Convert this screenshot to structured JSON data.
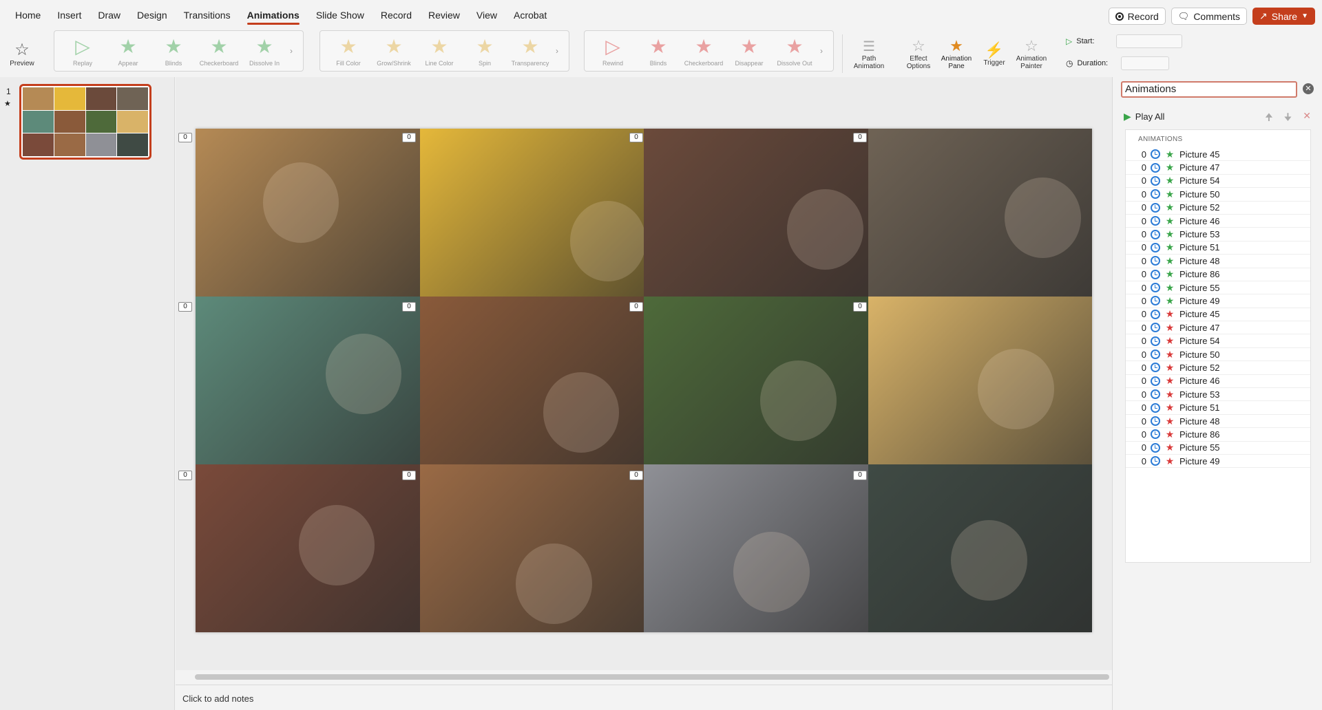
{
  "menu": {
    "tabs": [
      "Home",
      "Insert",
      "Draw",
      "Design",
      "Transitions",
      "Animations",
      "Slide Show",
      "Record",
      "Review",
      "View",
      "Acrobat"
    ],
    "active_tab": "Animations",
    "record_button": "Record",
    "comments_button": "Comments",
    "share_button": "Share"
  },
  "ribbon": {
    "preview_label": "Preview",
    "entrance_effects": [
      "Replay",
      "Appear",
      "Blinds",
      "Checkerboard",
      "Dissolve In"
    ],
    "emphasis_effects": [
      "Fill Color",
      "Grow/Shrink",
      "Line Color",
      "Spin",
      "Transparency"
    ],
    "exit_effects": [
      "Rewind",
      "Blinds",
      "Checkerboard",
      "Disappear",
      "Dissolve Out"
    ],
    "path_animation": "Path Animation",
    "effect_options": "Effect Options",
    "animation_pane": "Animation Pane",
    "trigger": "Trigger",
    "animation_painter": "Animation Painter",
    "start_label": "Start:",
    "duration_label": "Duration:"
  },
  "thumbnails": {
    "slide_number": "1",
    "star": "★"
  },
  "slide": {
    "badge_value": "0",
    "photo_colors": [
      "#b58a55",
      "#e5b83a",
      "#6b4a3b",
      "#6f6355",
      "#5d8a7a",
      "#8a5a3a",
      "#4e6a3a",
      "#d9b368",
      "#7a4a3a",
      "#9a6a45",
      "#8f9096",
      "#3f4a44"
    ]
  },
  "notes": {
    "placeholder": "Click to add notes"
  },
  "animation_pane": {
    "title": "Animations",
    "play_all": "Play All",
    "list_header": "ANIMATIONS",
    "items": [
      {
        "n": "0",
        "name": "Picture 45",
        "effect": "entrance"
      },
      {
        "n": "0",
        "name": "Picture 47",
        "effect": "entrance"
      },
      {
        "n": "0",
        "name": "Picture 54",
        "effect": "entrance"
      },
      {
        "n": "0",
        "name": "Picture 50",
        "effect": "entrance"
      },
      {
        "n": "0",
        "name": "Picture 52",
        "effect": "entrance"
      },
      {
        "n": "0",
        "name": "Picture 46",
        "effect": "entrance"
      },
      {
        "n": "0",
        "name": "Picture 53",
        "effect": "entrance"
      },
      {
        "n": "0",
        "name": "Picture 51",
        "effect": "entrance"
      },
      {
        "n": "0",
        "name": "Picture 48",
        "effect": "entrance"
      },
      {
        "n": "0",
        "name": "Picture 86",
        "effect": "entrance"
      },
      {
        "n": "0",
        "name": "Picture 55",
        "effect": "entrance"
      },
      {
        "n": "0",
        "name": "Picture 49",
        "effect": "entrance"
      },
      {
        "n": "0",
        "name": "Picture 45",
        "effect": "exit"
      },
      {
        "n": "0",
        "name": "Picture 47",
        "effect": "exit"
      },
      {
        "n": "0",
        "name": "Picture 54",
        "effect": "exit"
      },
      {
        "n": "0",
        "name": "Picture 50",
        "effect": "exit"
      },
      {
        "n": "0",
        "name": "Picture 52",
        "effect": "exit"
      },
      {
        "n": "0",
        "name": "Picture 46",
        "effect": "exit"
      },
      {
        "n": "0",
        "name": "Picture 53",
        "effect": "exit"
      },
      {
        "n": "0",
        "name": "Picture 51",
        "effect": "exit"
      },
      {
        "n": "0",
        "name": "Picture 48",
        "effect": "exit"
      },
      {
        "n": "0",
        "name": "Picture 86",
        "effect": "exit"
      },
      {
        "n": "0",
        "name": "Picture 55",
        "effect": "exit"
      },
      {
        "n": "0",
        "name": "Picture 49",
        "effect": "exit"
      }
    ]
  },
  "colors": {
    "accent": "#c43e1c",
    "entrance_star": "#3aa54a",
    "exit_star": "#d93a3a",
    "clock": "#2b7bd6"
  }
}
